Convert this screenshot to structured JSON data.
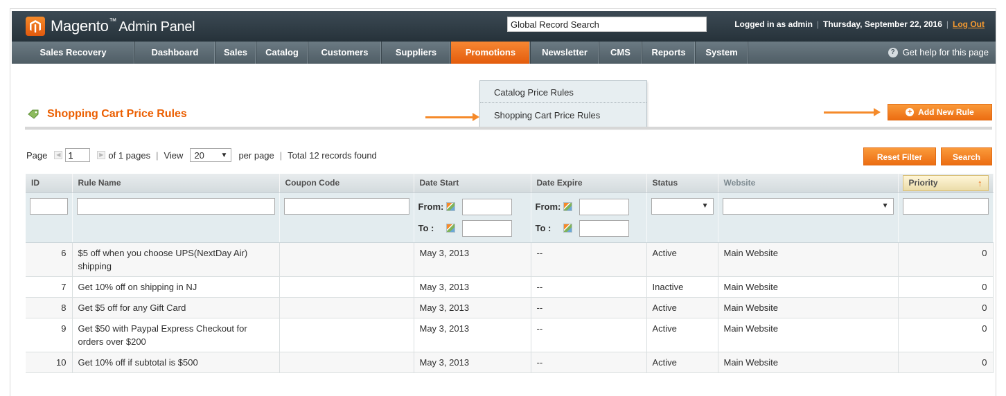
{
  "header": {
    "logo_text": "Magento",
    "logo_tm": "™",
    "logo_sub": "Admin Panel",
    "global_search_value": "Global Record Search",
    "logged_in": "Logged in as admin",
    "date": "Thursday, September 22, 2016",
    "logout": "Log Out"
  },
  "nav": {
    "items": [
      {
        "label": "Sales Recovery"
      },
      {
        "label": "Dashboard"
      },
      {
        "label": "Sales"
      },
      {
        "label": "Catalog"
      },
      {
        "label": "Customers"
      },
      {
        "label": "Suppliers"
      },
      {
        "label": "Promotions"
      },
      {
        "label": "Newsletter"
      },
      {
        "label": "CMS"
      },
      {
        "label": "Reports"
      },
      {
        "label": "System"
      }
    ],
    "active": "Promotions",
    "help": "Get help for this page"
  },
  "dropdown": {
    "items": [
      "Catalog Price Rules",
      "Shopping Cart Price Rules"
    ]
  },
  "page": {
    "title": "Shopping Cart Price Rules",
    "add_button": "Add New Rule"
  },
  "pager": {
    "page_label": "Page",
    "page_value": "1",
    "of_pages": "of 1 pages",
    "view_label": "View",
    "per_page_value": "20",
    "per_page_label": "per page",
    "total": "Total 12 records found",
    "reset_filter": "Reset Filter",
    "search": "Search"
  },
  "grid": {
    "columns": [
      "ID",
      "Rule Name",
      "Coupon Code",
      "Date Start",
      "Date Expire",
      "Status",
      "Website",
      "Priority"
    ],
    "filter": {
      "from_label": "From:",
      "to_label": "To :"
    },
    "rows": [
      {
        "id": "6",
        "name": "$5 off when you choose UPS(NextDay Air) shipping",
        "coupon": "",
        "start": "May 3, 2013",
        "expire": "--",
        "status": "Active",
        "website": "Main Website",
        "priority": "0"
      },
      {
        "id": "7",
        "name": "Get 10% off on shipping in NJ",
        "coupon": "",
        "start": "May 3, 2013",
        "expire": "--",
        "status": "Inactive",
        "website": "Main Website",
        "priority": "0"
      },
      {
        "id": "8",
        "name": "Get $5 off for any Gift Card",
        "coupon": "",
        "start": "May 3, 2013",
        "expire": "--",
        "status": "Active",
        "website": "Main Website",
        "priority": "0"
      },
      {
        "id": "9",
        "name": "Get $50 with Paypal Express Checkout for orders over $200",
        "coupon": "",
        "start": "May 3, 2013",
        "expire": "--",
        "status": "Active",
        "website": "Main Website",
        "priority": "0"
      },
      {
        "id": "10",
        "name": "Get 10% off if subtotal is $500",
        "coupon": "",
        "start": "May 3, 2013",
        "expire": "--",
        "status": "Active",
        "website": "Main Website",
        "priority": "0"
      }
    ]
  },
  "colors": {
    "accent": "#eb5e00",
    "header_bg": "#2f3c44",
    "nav_bg": "#5d6b73",
    "filter_bg": "#e3ecef"
  }
}
